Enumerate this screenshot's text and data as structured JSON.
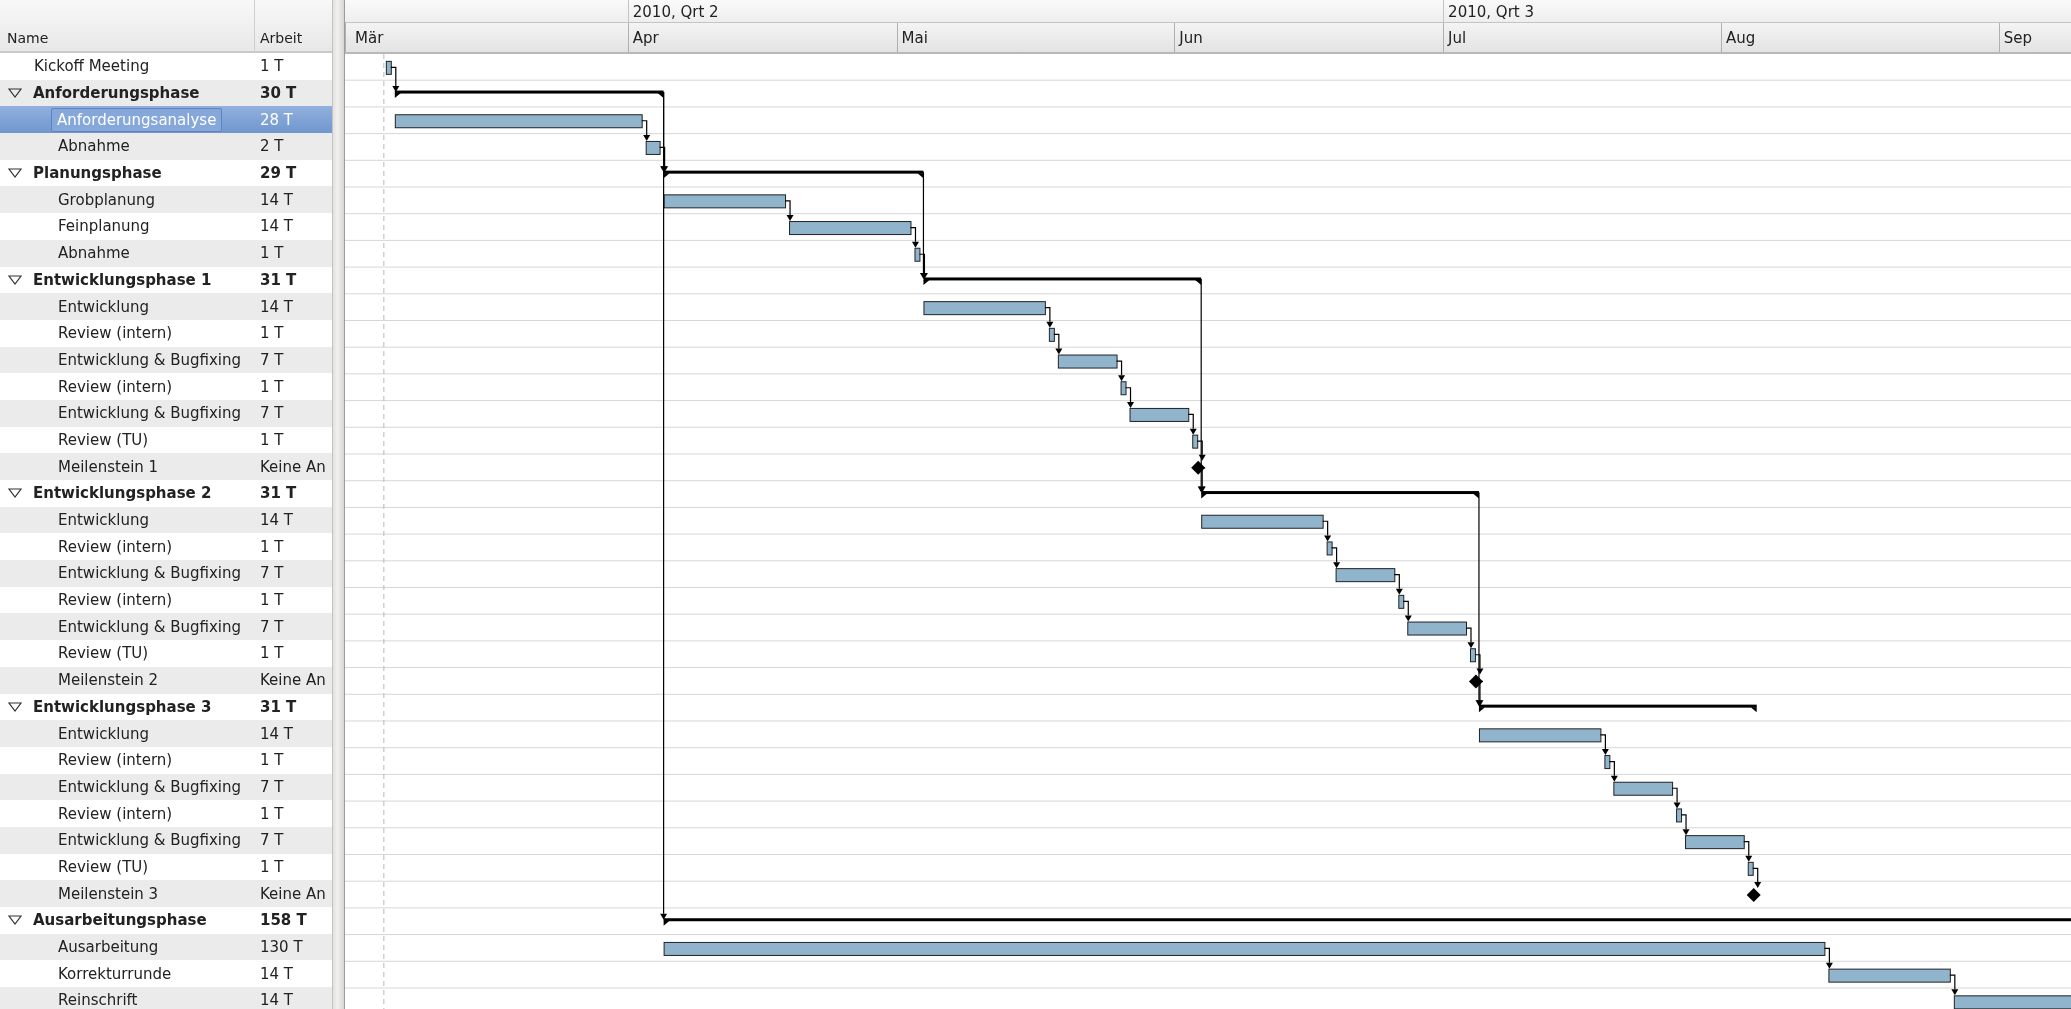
{
  "columns": [
    "Name",
    "Arbeit"
  ],
  "timeline": {
    "quarters": [
      "2010, Qrt 2",
      "2010, Qrt 3"
    ],
    "months": [
      "Mär",
      "Apr",
      "Mai",
      "Jun",
      "Jul",
      "Aug",
      "Sep"
    ]
  },
  "tasks": [
    {
      "kind": "task",
      "name": "Kickoff Meeting",
      "work": "1 T",
      "selected": false
    },
    {
      "kind": "phase",
      "name": "Anforderungsphase",
      "work": "30 T",
      "selected": false,
      "expanded": true,
      "parallel": false,
      "children": [
        {
          "kind": "task",
          "name": "Anforderungsanalyse",
          "work": "28 T",
          "selected": true
        },
        {
          "kind": "task",
          "name": "Abnahme",
          "work": "2 T",
          "selected": false
        }
      ]
    },
    {
      "kind": "phase",
      "name": "Planungsphase",
      "work": "29 T",
      "selected": false,
      "expanded": true,
      "parallel": false,
      "children": [
        {
          "kind": "task",
          "name": "Grobplanung",
          "work": "14 T",
          "selected": false
        },
        {
          "kind": "task",
          "name": "Feinplanung",
          "work": "14 T",
          "selected": false
        },
        {
          "kind": "task",
          "name": "Abnahme",
          "work": "1 T",
          "selected": false
        }
      ]
    },
    {
      "kind": "phase",
      "name": "Entwicklungsphase 1",
      "work": "31 T",
      "selected": false,
      "expanded": true,
      "parallel": false,
      "children": [
        {
          "kind": "task",
          "name": "Entwicklung",
          "work": "14 T",
          "selected": false
        },
        {
          "kind": "task",
          "name": "Review (intern)",
          "work": "1 T",
          "selected": false
        },
        {
          "kind": "task",
          "name": "Entwicklung & Bugfixing",
          "work": "7 T",
          "selected": false
        },
        {
          "kind": "task",
          "name": "Review (intern)",
          "work": "1 T",
          "selected": false
        },
        {
          "kind": "task",
          "name": "Entwicklung & Bugfixing",
          "work": "7 T",
          "selected": false
        },
        {
          "kind": "task",
          "name": "Review (TU)",
          "work": "1 T",
          "selected": false
        },
        {
          "kind": "milestone",
          "name": "Meilenstein 1",
          "work": "Keine An",
          "selected": false
        }
      ]
    },
    {
      "kind": "phase",
      "name": "Entwicklungsphase 2",
      "work": "31 T",
      "selected": false,
      "expanded": true,
      "parallel": false,
      "children": [
        {
          "kind": "task",
          "name": "Entwicklung",
          "work": "14 T",
          "selected": false
        },
        {
          "kind": "task",
          "name": "Review (intern)",
          "work": "1 T",
          "selected": false
        },
        {
          "kind": "task",
          "name": "Entwicklung & Bugfixing",
          "work": "7 T",
          "selected": false
        },
        {
          "kind": "task",
          "name": "Review (intern)",
          "work": "1 T",
          "selected": false
        },
        {
          "kind": "task",
          "name": "Entwicklung & Bugfixing",
          "work": "7 T",
          "selected": false
        },
        {
          "kind": "task",
          "name": "Review (TU)",
          "work": "1 T",
          "selected": false
        },
        {
          "kind": "milestone",
          "name": "Meilenstein 2",
          "work": "Keine An",
          "selected": false
        }
      ]
    },
    {
      "kind": "phase",
      "name": "Entwicklungsphase 3",
      "work": "31 T",
      "selected": false,
      "expanded": true,
      "parallel": false,
      "children": [
        {
          "kind": "task",
          "name": "Entwicklung",
          "work": "14 T",
          "selected": false
        },
        {
          "kind": "task",
          "name": "Review (intern)",
          "work": "1 T",
          "selected": false
        },
        {
          "kind": "task",
          "name": "Entwicklung & Bugfixing",
          "work": "7 T",
          "selected": false
        },
        {
          "kind": "task",
          "name": "Review (intern)",
          "work": "1 T",
          "selected": false
        },
        {
          "kind": "task",
          "name": "Entwicklung & Bugfixing",
          "work": "7 T",
          "selected": false
        },
        {
          "kind": "task",
          "name": "Review (TU)",
          "work": "1 T",
          "selected": false
        },
        {
          "kind": "milestone",
          "name": "Meilenstein 3",
          "work": "Keine An",
          "selected": false
        }
      ]
    },
    {
      "kind": "phase",
      "name": "Ausarbeitungsphase",
      "work": "158 T",
      "selected": false,
      "expanded": true,
      "parallel": true,
      "children": [
        {
          "kind": "task",
          "name": "Ausarbeitung",
          "work": "130 T",
          "selected": false
        },
        {
          "kind": "task",
          "name": "Korrekturrunde",
          "work": "14 T",
          "selected": false
        },
        {
          "kind": "task",
          "name": "Reinschrift",
          "work": "14 T",
          "selected": false
        }
      ]
    }
  ]
}
